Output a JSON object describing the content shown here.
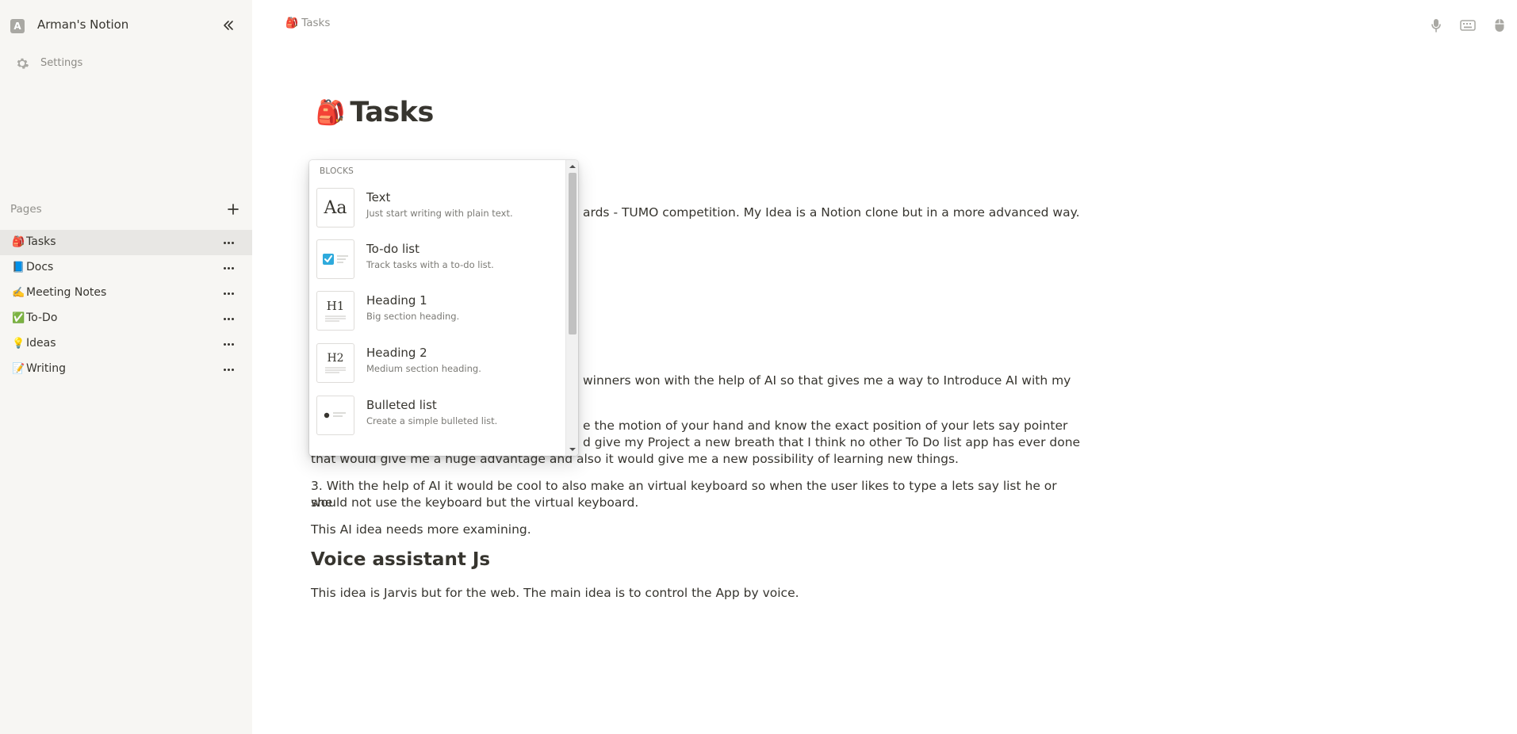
{
  "sidebar": {
    "workspace_initial": "A",
    "workspace_name": "Arman's Notion",
    "settings_label": "Settings",
    "pages_label": "Pages",
    "pages": [
      {
        "emoji": "🎒",
        "label": "Tasks",
        "active": true
      },
      {
        "emoji": "📘",
        "label": "Docs"
      },
      {
        "emoji": "✍️",
        "label": "Meeting Notes"
      },
      {
        "emoji": "✅",
        "label": "To-Do"
      },
      {
        "emoji": "💡",
        "label": "Ideas"
      },
      {
        "emoji": "📝",
        "label": "Writing"
      }
    ]
  },
  "topbar": {
    "breadcrumb_emoji": "🎒",
    "breadcrumb_label": "Tasks",
    "icons": [
      "microphone-icon",
      "keyboard-icon",
      "mouse-icon"
    ]
  },
  "page": {
    "emoji": "🎒",
    "title": "Tasks",
    "paragraphs": [
      "ards - TUMO  competition. My Idea is a Notion clone but in a more advanced way.",
      "winners won with the help of AI so that gives me a way to Introduce AI with my",
      "e the motion of your hand and know the exact position of your lets say pointer",
      "d give my Project a new breath that I think no other To Do list app has ever done",
      "that would give me a huge advantage and also it would give me a new possibility of learning new things.",
      "3.  With the help of AI it would be cool to also make an virtual keyboard so when the user likes to type a lets say list he or she",
      "would not use the keyboard but the virtual keyboard.",
      "This AI idea needs more examining."
    ],
    "heading": "Voice assistant Js",
    "final_paragraph": "This idea is Jarvis but for the web. The main idea is to control the App by voice."
  },
  "block_menu": {
    "section_label": "BLOCKS",
    "items": [
      {
        "title": "Text",
        "description": "Just start writing with plain text.",
        "icon": "text-block-icon"
      },
      {
        "title": "To-do list",
        "description": "Track tasks with a to-do list.",
        "icon": "todo-block-icon"
      },
      {
        "title": "Heading 1",
        "description": "Big section heading.",
        "icon": "heading1-block-icon"
      },
      {
        "title": "Heading 2",
        "description": "Medium section heading.",
        "icon": "heading2-block-icon"
      },
      {
        "title": "Bulleted list",
        "description": "Create a simple bulleted list.",
        "icon": "bulleted-list-block-icon"
      }
    ],
    "thumb_text": {
      "text": "Aa",
      "h1": "H1",
      "h2": "H2"
    }
  },
  "colors": {
    "sidebar_bg": "#f7f6f3",
    "text": "#37352f",
    "muted": "#91908b",
    "checkbox": "#2eaadc"
  }
}
